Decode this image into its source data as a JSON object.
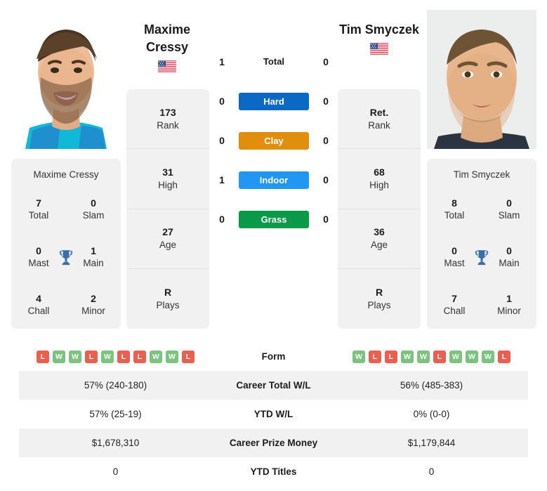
{
  "players": {
    "left": {
      "name_line1": "Maxime",
      "name_line2": "Cressy",
      "full_name": "Maxime Cressy",
      "flag": "us-flag-icon",
      "stats": [
        {
          "value": "173",
          "label": "Rank"
        },
        {
          "value": "31",
          "label": "High"
        },
        {
          "value": "27",
          "label": "Age"
        },
        {
          "value": "R",
          "label": "Plays"
        }
      ],
      "titles": [
        {
          "value": "7",
          "label": "Total"
        },
        {
          "value": "0",
          "label": "Slam"
        },
        {
          "value": "0",
          "label": "Mast"
        },
        {
          "value": "1",
          "label": "Main"
        },
        {
          "value": "4",
          "label": "Chall"
        },
        {
          "value": "2",
          "label": "Minor"
        }
      ],
      "form": [
        "L",
        "W",
        "W",
        "L",
        "W",
        "L",
        "L",
        "W",
        "W",
        "L"
      ],
      "career_total_wl": "57% (240-180)",
      "ytd_wl": "57% (25-19)",
      "career_prize_money": "$1,678,310",
      "ytd_titles": "0"
    },
    "right": {
      "name_line1": "Tim Smyczek",
      "name_line2": "",
      "full_name": "Tim Smyczek",
      "flag": "us-flag-icon",
      "stats": [
        {
          "value": "Ret.",
          "label": "Rank"
        },
        {
          "value": "68",
          "label": "High"
        },
        {
          "value": "36",
          "label": "Age"
        },
        {
          "value": "R",
          "label": "Plays"
        }
      ],
      "titles": [
        {
          "value": "8",
          "label": "Total"
        },
        {
          "value": "0",
          "label": "Slam"
        },
        {
          "value": "0",
          "label": "Mast"
        },
        {
          "value": "0",
          "label": "Main"
        },
        {
          "value": "7",
          "label": "Chall"
        },
        {
          "value": "1",
          "label": "Minor"
        }
      ],
      "form": [
        "W",
        "L",
        "L",
        "W",
        "W",
        "L",
        "W",
        "W",
        "W",
        "L"
      ],
      "career_total_wl": "56% (485-383)",
      "ytd_wl": "0% (0-0)",
      "career_prize_money": "$1,179,844",
      "ytd_titles": "0"
    }
  },
  "head_to_head": [
    {
      "label": "Total",
      "left": "1",
      "right": "0",
      "color": ""
    },
    {
      "label": "Hard",
      "left": "0",
      "right": "0",
      "color": "#0969c3"
    },
    {
      "label": "Clay",
      "left": "0",
      "right": "0",
      "color": "#e08e0b"
    },
    {
      "label": "Indoor",
      "left": "1",
      "right": "0",
      "color": "#2196f3"
    },
    {
      "label": "Grass",
      "left": "0",
      "right": "0",
      "color": "#089949"
    }
  ],
  "table_labels": {
    "form": "Form",
    "career_total_wl": "Career Total W/L",
    "ytd_wl": "YTD W/L",
    "career_prize_money": "Career Prize Money",
    "ytd_titles": "YTD Titles"
  },
  "colors": {
    "hard": "#0969c3",
    "clay": "#e08e0b",
    "indoor": "#2196f3",
    "grass": "#089949",
    "win": "#7cc47e",
    "loss": "#ea5f4f",
    "trophy": "#3a6ea8",
    "panel": "#f1f1f1"
  }
}
